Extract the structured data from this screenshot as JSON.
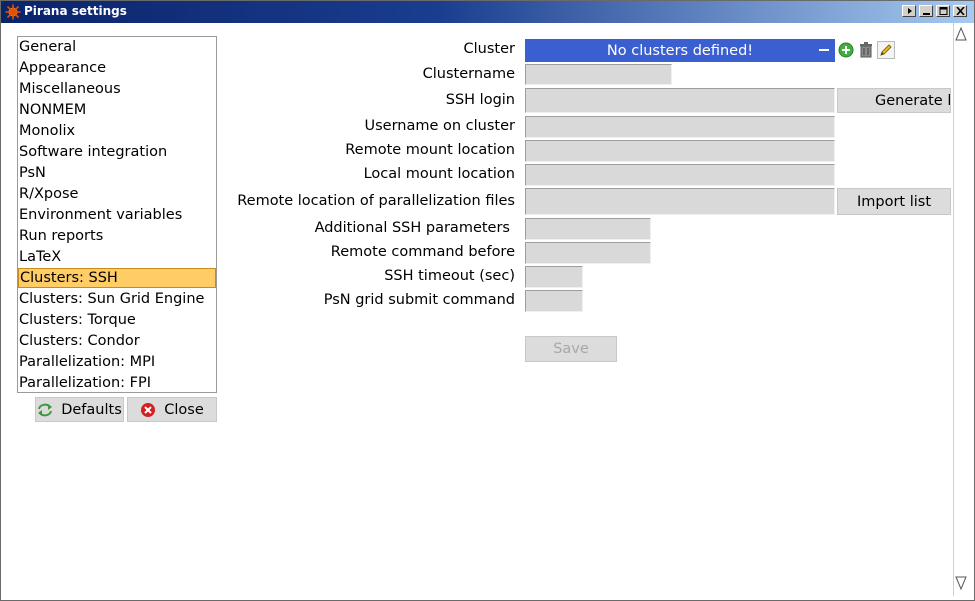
{
  "window": {
    "title": "Pirana settings",
    "controls": [
      "menu-icon",
      "minimize-icon",
      "maximize-icon",
      "close-icon"
    ]
  },
  "sidebar": {
    "items": [
      {
        "label": "General",
        "selected": false
      },
      {
        "label": "Appearance",
        "selected": false
      },
      {
        "label": "Miscellaneous",
        "selected": false
      },
      {
        "label": "NONMEM",
        "selected": false
      },
      {
        "label": "Monolix",
        "selected": false
      },
      {
        "label": "Software integration",
        "selected": false
      },
      {
        "label": "PsN",
        "selected": false
      },
      {
        "label": "R/Xpose",
        "selected": false
      },
      {
        "label": "Environment variables",
        "selected": false
      },
      {
        "label": "Run reports",
        "selected": false
      },
      {
        "label": "LaTeX",
        "selected": false
      },
      {
        "label": "Clusters: SSH",
        "selected": true
      },
      {
        "label": "Clusters: Sun Grid Engine",
        "selected": false
      },
      {
        "label": "Clusters: Torque",
        "selected": false
      },
      {
        "label": "Clusters: Condor",
        "selected": false
      },
      {
        "label": "Parallelization: MPI",
        "selected": false
      },
      {
        "label": "Parallelization: FPI",
        "selected": false
      }
    ],
    "defaults_label": "Defaults",
    "close_label": "Close"
  },
  "form": {
    "cluster_label": "Cluster",
    "cluster_value": "No clusters defined!",
    "clustername_label": "Clustername",
    "clustername_value": "",
    "ssh_login_label": "SSH login",
    "ssh_login_value": "",
    "generate_label": "Generate l",
    "username_label": "Username on cluster",
    "username_value": "",
    "remote_mount_label": "Remote mount location",
    "remote_mount_value": "",
    "local_mount_label": "Local mount location",
    "local_mount_value": "",
    "remote_parallel_label": "Remote location of parallelization files",
    "remote_parallel_value": "",
    "import_list_label": "Import list",
    "additional_ssh_label": "Additional SSH parameters",
    "additional_ssh_value": "",
    "remote_cmd_label": "Remote command before",
    "remote_cmd_value": "",
    "ssh_timeout_label": "SSH timeout (sec)",
    "ssh_timeout_value": "",
    "psn_grid_label": "PsN grid submit command",
    "psn_grid_value": "",
    "save_label": "Save"
  },
  "colors": {
    "selection": "#ffcc66",
    "dropdown": "#3a5fd0",
    "title_bar": "#0a246a"
  }
}
